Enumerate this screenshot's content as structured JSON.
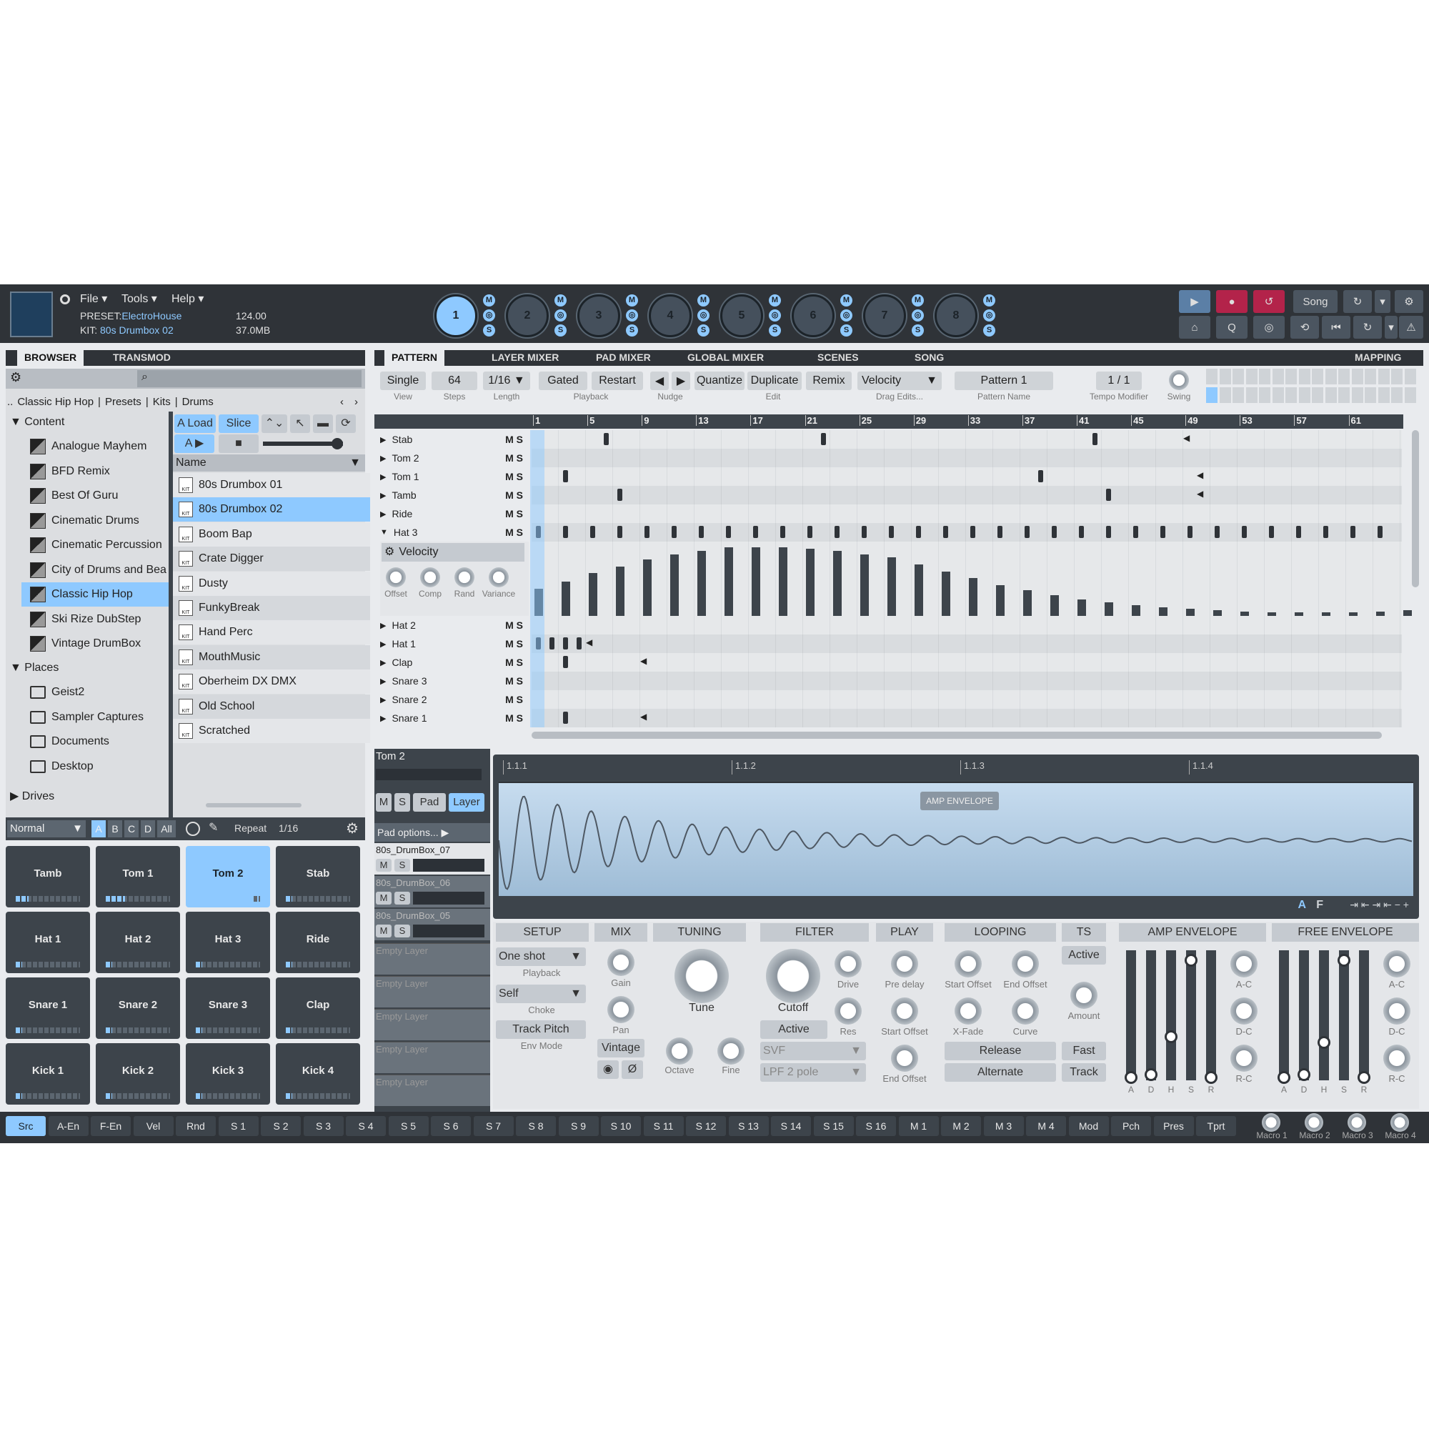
{
  "menu": {
    "file": "File ▾",
    "tools": "Tools ▾",
    "help": "Help ▾"
  },
  "preset": {
    "preset_label": "PRESET:",
    "preset_name": "ElectroHouse",
    "kit_label": "KIT:",
    "kit_name": "80s Drumbox 02",
    "tempo": "124.00",
    "memory": "37.0MB"
  },
  "scenes": [
    "1",
    "2",
    "3",
    "4",
    "5",
    "6",
    "7",
    "8"
  ],
  "transport": {
    "song_label": "Song",
    "q_label": "Q"
  },
  "left_tabs": {
    "browser": "BROWSER",
    "transmod": "TRANSMOD"
  },
  "main_tabs": {
    "pattern": "PATTERN",
    "layer_mixer": "LAYER MIXER",
    "pad_mixer": "PAD MIXER",
    "global_mixer": "GLOBAL MIXER",
    "scenes": "SCENES",
    "song": "SONG",
    "mapping": "MAPPING"
  },
  "breadcrumb": {
    "root": "..",
    "items": [
      "Classic Hip Hop",
      "Presets",
      "Kits",
      "Drums"
    ]
  },
  "tree": {
    "content_label": "Content",
    "content": [
      "Analogue Mayhem",
      "BFD Remix",
      "Best Of Guru",
      "Cinematic Drums",
      "Cinematic Percussion",
      "City of Drums and Bea",
      "Classic Hip Hop",
      "Ski Rize DubStep",
      "Vintage DrumBox"
    ],
    "selected_index": 6,
    "places_label": "Places",
    "places": [
      "Geist2",
      "Sampler Captures",
      "Documents",
      "Desktop"
    ],
    "drives_label": "Drives"
  },
  "file_panel": {
    "load": "A Load",
    "slice": "Slice",
    "a": "A ▶",
    "name_header": "Name",
    "files": [
      "80s Drumbox 01",
      "80s Drumbox 02",
      "Boom Bap",
      "Crate Digger",
      "Dusty",
      "FunkyBreak",
      "Hand Perc",
      "MouthMusic",
      "Oberheim DX DMX",
      "Old School",
      "Scratched"
    ],
    "selected_index": 1,
    "kit_tag": "KIT"
  },
  "pad_bar": {
    "mode": "Normal",
    "banks": [
      "A",
      "B",
      "C",
      "D",
      "All"
    ],
    "repeat": "Repeat",
    "rate": "1/16"
  },
  "pads": [
    {
      "name": "Tamb",
      "level": 0.2
    },
    {
      "name": "Tom 1",
      "level": 0.3
    },
    {
      "name": "Tom 2",
      "level": 0.9
    },
    {
      "name": "Stab",
      "level": 0.1
    },
    {
      "name": "Hat 1",
      "level": 0.1
    },
    {
      "name": "Hat 2",
      "level": 0.1
    },
    {
      "name": "Hat 3",
      "level": 0.1
    },
    {
      "name": "Ride",
      "level": 0.1
    },
    {
      "name": "Snare 1",
      "level": 0.1
    },
    {
      "name": "Snare 2",
      "level": 0.1
    },
    {
      "name": "Snare 3",
      "level": 0.1
    },
    {
      "name": "Clap",
      "level": 0.1
    },
    {
      "name": "Kick 1",
      "level": 0.1
    },
    {
      "name": "Kick 2",
      "level": 0.1
    },
    {
      "name": "Kick 3",
      "level": 0.1
    },
    {
      "name": "Kick 4",
      "level": 0.1
    }
  ],
  "pads_selected": 2,
  "pattern_bar": {
    "view": "Single",
    "view_lbl": "View",
    "steps": "64",
    "steps_lbl": "Steps",
    "length": "1/16",
    "length_lbl": "Length",
    "gated": "Gated",
    "restart": "Restart",
    "playback_lbl": "Playback",
    "nudge_lbl": "Nudge",
    "quantize": "Quantize",
    "duplicate": "Duplicate",
    "remix": "Remix",
    "edit_lbl": "Edit",
    "velocity": "Velocity",
    "drag_lbl": "Drag Edits...",
    "pattern_name": "Pattern 1",
    "pattern_name_lbl": "Pattern Name",
    "tempo_mod": "1 / 1",
    "tempo_mod_lbl": "Tempo Modifier",
    "swing_lbl": "Swing"
  },
  "ruler": [
    "1",
    "5",
    "9",
    "13",
    "17",
    "21",
    "25",
    "29",
    "33",
    "37",
    "41",
    "45",
    "49",
    "53",
    "57",
    "61"
  ],
  "ms_label": "M S",
  "rows": [
    "Stab",
    "Tom 2",
    "Tom 1",
    "Tamb",
    "Ride",
    "Hat 3",
    "Hat 2",
    "Hat 1",
    "Clap",
    "Snare 3",
    "Snare 2",
    "Snare 1"
  ],
  "velocity_lane": {
    "label": "Velocity",
    "knobs": [
      "Offset",
      "Comp",
      "Rand",
      "Variance"
    ],
    "values": [
      0.4,
      0.5,
      0.62,
      0.72,
      0.82,
      0.9,
      0.95,
      1.0,
      1.0,
      1.0,
      0.98,
      0.95,
      0.9,
      0.85,
      0.75,
      0.65,
      0.55,
      0.45,
      0.38,
      0.3,
      0.24,
      0.2,
      0.16,
      0.13,
      0.1,
      0.08,
      0.06,
      0.05,
      0.05,
      0.05,
      0.05,
      0.06,
      0.08,
      0.1,
      0.14,
      0.2,
      0.28,
      0.36
    ]
  },
  "layers": {
    "pad_name": "Tom 2",
    "m": "M",
    "s": "S",
    "pad": "Pad",
    "layer": "Layer",
    "pad_options": "Pad options... ▶",
    "items": [
      "80s_DrumBox_07",
      "80s_DrumBox_06",
      "80s_DrumBox_05"
    ],
    "empty": [
      "Empty Layer",
      "Empty Layer",
      "Empty Layer",
      "Empty Layer",
      "Empty Layer"
    ]
  },
  "waveform": {
    "markers": [
      "1.1.1",
      "1.1.2",
      "1.1.3",
      "1.1.4"
    ],
    "envelope_tag": "AMP ENVELOPE",
    "a": "A",
    "f": "F"
  },
  "sections": {
    "setup": {
      "title": "SETUP",
      "playback": "One shot",
      "playback_lbl": "Playback",
      "choke": "Self",
      "choke_lbl": "Choke",
      "env": "Track Pitch",
      "env_lbl": "Env Mode"
    },
    "mix": {
      "title": "MIX",
      "gain": "Gain",
      "pan": "Pan",
      "vintage": "Vintage"
    },
    "tuning": {
      "title": "TUNING",
      "tune": "Tune",
      "octave": "Octave",
      "fine": "Fine"
    },
    "filter": {
      "title": "FILTER",
      "cutoff": "Cutoff",
      "drive": "Drive",
      "res": "Res",
      "active": "Active",
      "type": "SVF",
      "pole": "LPF 2 pole"
    },
    "play": {
      "title": "PLAY",
      "pre_delay": "Pre delay",
      "start_offset": "Start Offset",
      "end_offset": "End Offset"
    },
    "looping": {
      "title": "LOOPING",
      "start_offset": "Start Offset",
      "end_offset": "End Offset",
      "xfade": "X-Fade",
      "curve": "Curve",
      "release": "Release",
      "alternate": "Alternate"
    },
    "ts": {
      "title": "TS",
      "active": "Active",
      "amount": "Amount",
      "fast": "Fast",
      "track": "Track"
    },
    "amp_env": {
      "title": "AMP ENVELOPE",
      "sliders": [
        "A",
        "D",
        "H",
        "S",
        "R"
      ],
      "levels": [
        0.02,
        0.04,
        0.35,
        0.97,
        0.02
      ],
      "knobs": [
        "A-C",
        "D-C",
        "R-C"
      ]
    },
    "free_env": {
      "title": "FREE ENVELOPE",
      "sliders": [
        "A",
        "D",
        "H",
        "S",
        "R"
      ],
      "levels": [
        0.02,
        0.04,
        0.3,
        0.97,
        0.02
      ],
      "knobs": [
        "A-C",
        "D-C",
        "R-C"
      ]
    }
  },
  "footer_tabs": [
    "Src",
    "A-En",
    "F-En",
    "Vel",
    "Rnd",
    "S 1",
    "S 2",
    "S 3",
    "S 4",
    "S 5",
    "S 6",
    "S 7",
    "S 8",
    "S 9",
    "S 10",
    "S 11",
    "S 12",
    "S 13",
    "S 14",
    "S 15",
    "S 16",
    "M 1",
    "M 2",
    "M 3",
    "M 4",
    "Mod",
    "Pch",
    "Pres",
    "Tprt"
  ],
  "macros": [
    "Macro 1",
    "Macro 2",
    "Macro 3",
    "Macro 4"
  ],
  "colors": {
    "accent": "#8ec9ff",
    "dark": "#2f3338",
    "record": "#b3234a"
  }
}
